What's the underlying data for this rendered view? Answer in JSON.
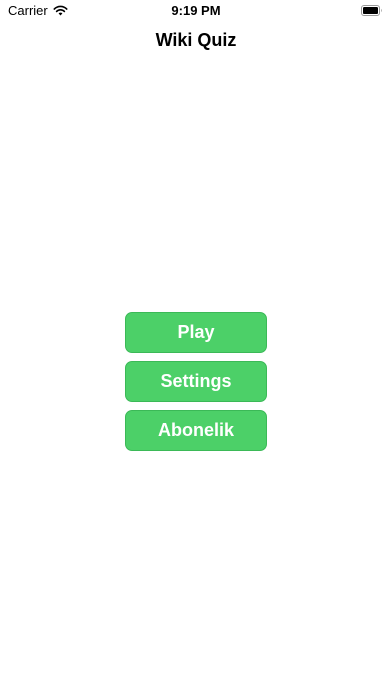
{
  "status_bar": {
    "carrier": "Carrier",
    "time": "9:19 PM",
    "wifi_icon": "wifi-icon",
    "battery_icon": "battery-icon"
  },
  "nav": {
    "title": "Wiki Quiz"
  },
  "menu": {
    "play_label": "Play",
    "settings_label": "Settings",
    "subscription_label": "Abonelik"
  },
  "colors": {
    "button_fill": "#4cd068",
    "button_border": "#3bb957",
    "button_text": "#ffffff",
    "background": "#ffffff"
  }
}
